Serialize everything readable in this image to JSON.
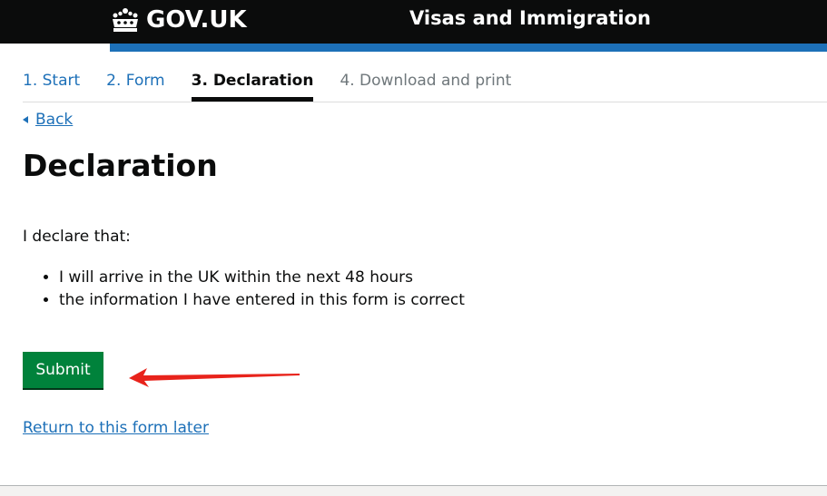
{
  "header": {
    "logo_text": "GOV.UK",
    "service_name": "Visas and Immigration",
    "logo_icon": "crown-icon"
  },
  "steps": [
    {
      "label": "1. Start",
      "state": "complete"
    },
    {
      "label": "2. Form",
      "state": "complete"
    },
    {
      "label": "3. Declaration",
      "state": "current"
    },
    {
      "label": "4. Download and print",
      "state": "future"
    }
  ],
  "back": {
    "label": "Back",
    "icon": "back-triangle-icon"
  },
  "page_title": "Declaration",
  "intro": "I declare that:",
  "declarations": [
    "I will arrive in the UK within the next 48 hours",
    "the information I have entered in this form is correct"
  ],
  "submit_label": "Submit",
  "return_later_label": "Return to this form later",
  "annotation": {
    "type": "red-arrow-pointing-left",
    "color": "#e8231b"
  },
  "colors": {
    "header": "#0b0c0c",
    "header_bar": "#1d70b8",
    "link": "#1d70b8",
    "button": "#00823b",
    "future_step": "#6f777b"
  }
}
